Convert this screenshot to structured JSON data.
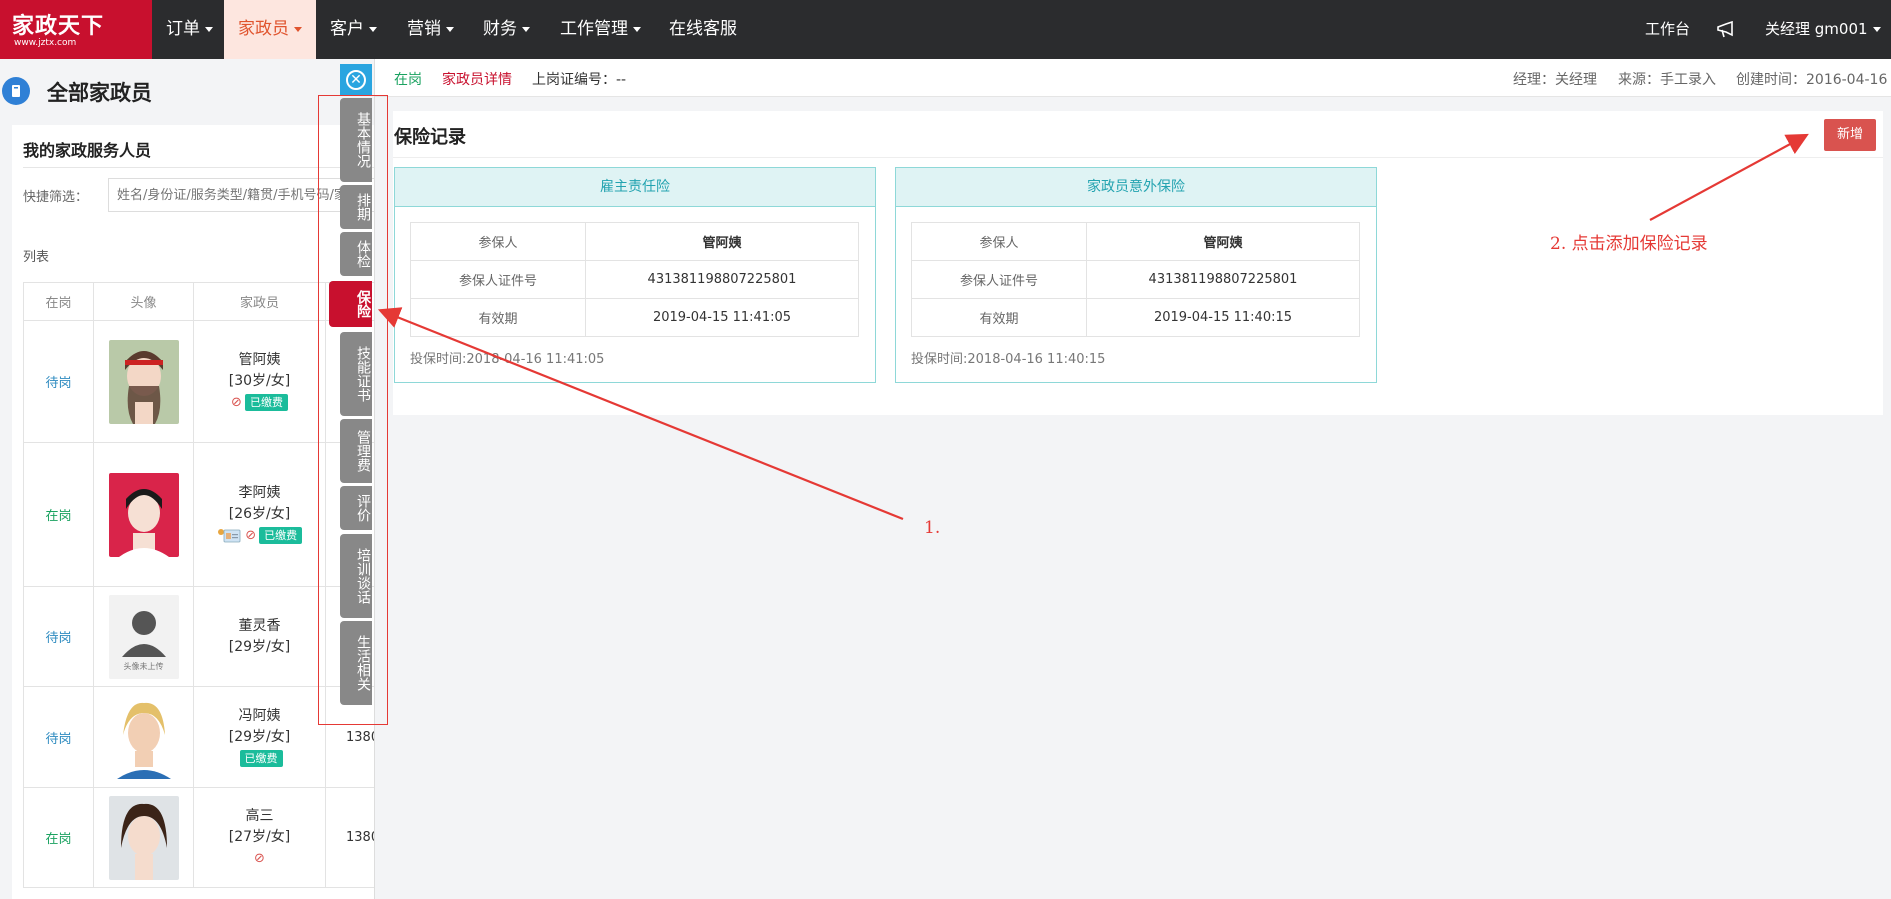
{
  "logo": {
    "brand": "家政天下",
    "url": "www.jztx.com"
  },
  "nav": {
    "items": [
      {
        "label": "订单",
        "caret": true
      },
      {
        "label": "家政员",
        "caret": true,
        "active": true
      },
      {
        "label": "客户",
        "caret": true
      },
      {
        "label": "营销",
        "caret": true
      },
      {
        "label": "财务",
        "caret": true
      },
      {
        "label": "工作管理",
        "caret": true
      },
      {
        "label": "在线客服",
        "caret": false
      }
    ],
    "workbench": "工作台",
    "user": "关经理 gm001"
  },
  "left": {
    "page_title": "全部家政员",
    "section_title": "我的家政服务人员",
    "filter_label": "快捷筛选：",
    "filter_placeholder": "姓名/身份证/服务类型/籍贯/手机号码/家",
    "list_label": "列表",
    "columns": [
      "在岗",
      "头像",
      "家政员"
    ],
    "rows": [
      {
        "status": "待岗",
        "name": "管阿姨",
        "info": "[30岁/女]",
        "paid": "已缴费",
        "phone": ""
      },
      {
        "status": "在岗",
        "name": "李阿姨",
        "info": "[26岁/女]",
        "paid": "已缴费",
        "phone": ""
      },
      {
        "status": "待岗",
        "name": "董灵香",
        "info": "[29岁/女]",
        "paid": "",
        "phone": "",
        "avatar_text": "头像未上传"
      },
      {
        "status": "待岗",
        "name": "冯阿姨",
        "info": "[29岁/女]",
        "paid": "已缴费",
        "phone": "1380"
      },
      {
        "status": "在岗",
        "name": "高三",
        "info": "[27岁/女]",
        "paid": "",
        "phone": "1380"
      }
    ]
  },
  "tabs": [
    {
      "label": "基本情况"
    },
    {
      "label": "排期"
    },
    {
      "label": "体检"
    },
    {
      "label": "保险",
      "active": true
    },
    {
      "label": "技能证书"
    },
    {
      "label": "管理费"
    },
    {
      "label": "评价"
    },
    {
      "label": "培训谈话"
    },
    {
      "label": "生活相关"
    }
  ],
  "detail": {
    "status": "在岗",
    "link": "家政员详情",
    "cert_no": "上岗证编号：--",
    "manager": "经理：关经理",
    "source": "来源：手工录入",
    "created": "创建时间：2016-04-16",
    "section_title": "保险记录",
    "add_button": "新增",
    "cards": [
      {
        "title": "雇主责任险",
        "rows": [
          {
            "k": "参保人",
            "v": "管阿姨"
          },
          {
            "k": "参保人证件号",
            "v": "431381198807225801"
          },
          {
            "k": "有效期",
            "v": "2019-04-15 11:41:05"
          }
        ],
        "time": "投保时间:2018-04-16 11:41:05"
      },
      {
        "title": "家政员意外保险",
        "rows": [
          {
            "k": "参保人",
            "v": "管阿姨"
          },
          {
            "k": "参保人证件号",
            "v": "431381198807225801"
          },
          {
            "k": "有效期",
            "v": "2019-04-15 11:40:15"
          }
        ],
        "time": "投保时间:2018-04-16 11:40:15"
      }
    ]
  },
  "annotations": {
    "step1": "1.",
    "step2": "2. 点击添加保险记录"
  },
  "colors": {
    "brand": "#c8102e",
    "accent": "#2aa5e0",
    "annotation": "#e53935"
  }
}
